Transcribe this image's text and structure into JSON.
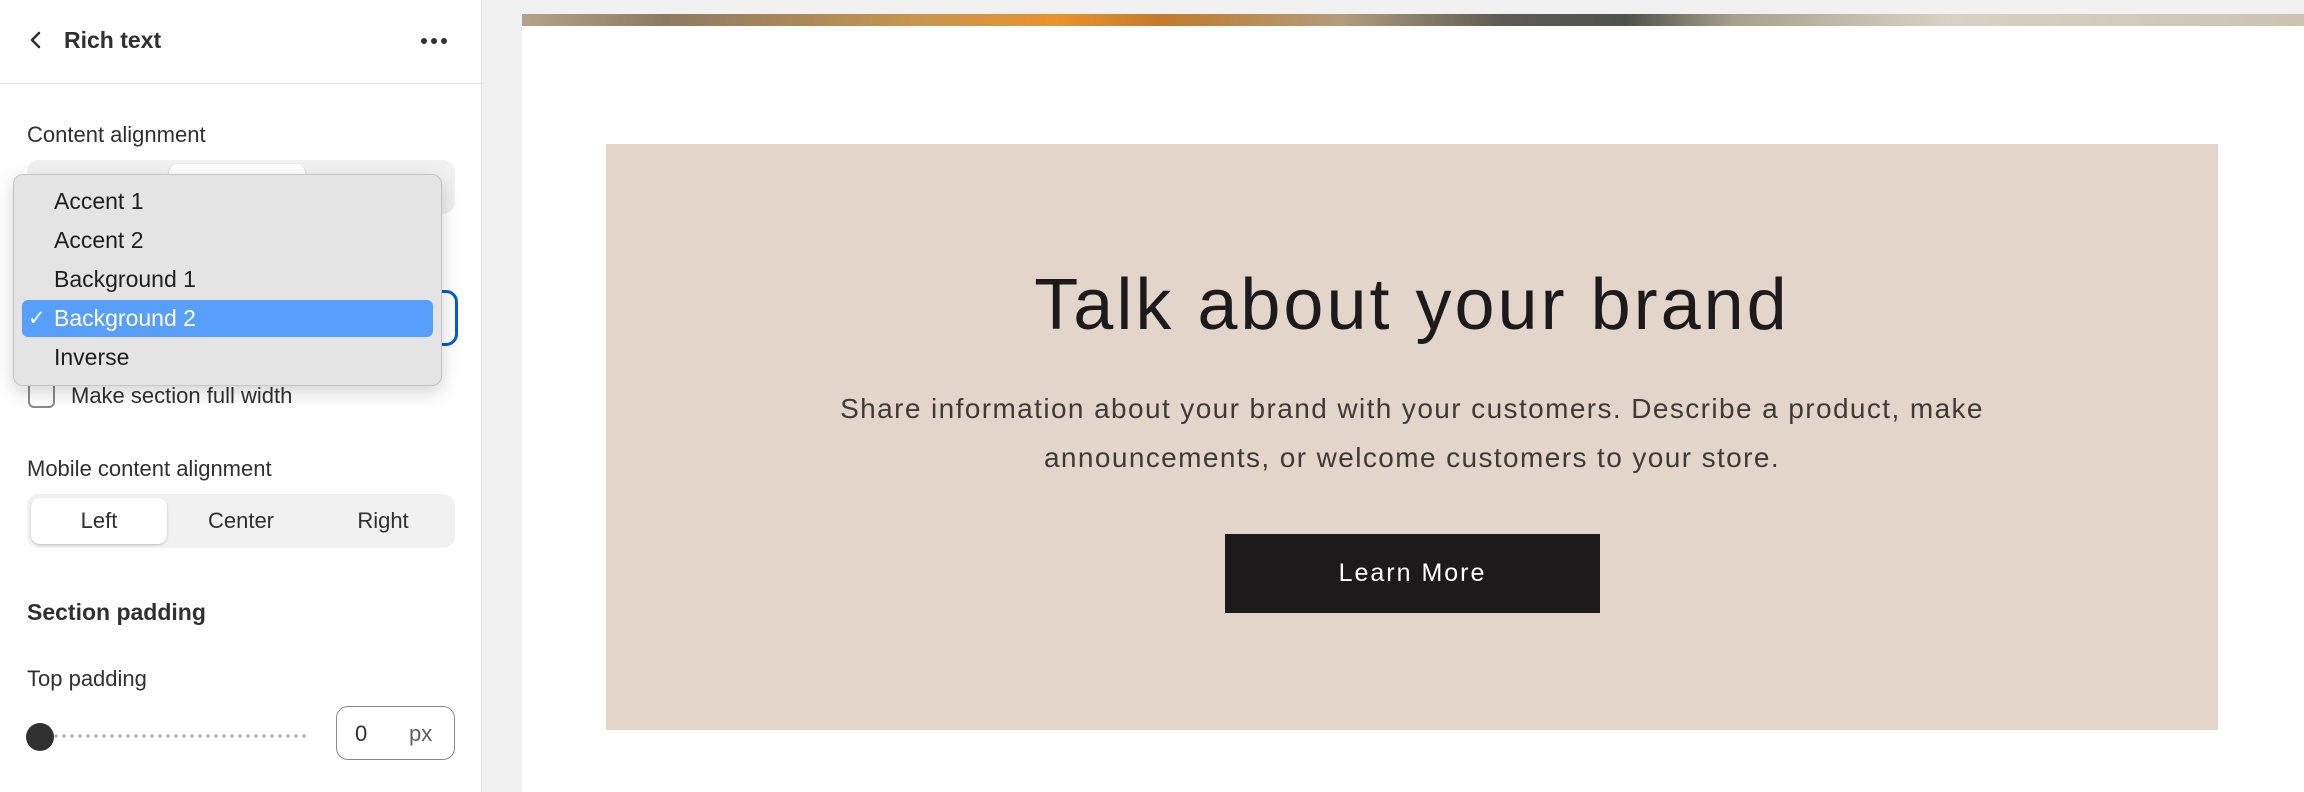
{
  "sidebar": {
    "title": "Rich text",
    "content_alignment": {
      "label": "Content alignment"
    },
    "color_scheme": {
      "options": [
        "Accent 1",
        "Accent 2",
        "Background 1",
        "Background 2",
        "Inverse"
      ],
      "selected": "Background 2",
      "check_glyph": "✓"
    },
    "full_width": {
      "label": "Make section full width",
      "checked": false
    },
    "mobile_alignment": {
      "label": "Mobile content alignment",
      "options": [
        "Left",
        "Center",
        "Right"
      ],
      "selected": "Left"
    },
    "section_padding": {
      "heading": "Section padding",
      "top_padding": {
        "label": "Top padding",
        "value": "0",
        "unit": "px"
      }
    }
  },
  "preview": {
    "heading": "Talk about your brand",
    "text": "Share information about your brand with your customers. Describe a product, make announcements, or welcome customers to your store.",
    "button": "Learn More"
  },
  "colors": {
    "accent": "#005bd3",
    "section_background": "#e3d5c9",
    "button_background": "#1c1a1a",
    "dropdown_selected": "#579ffb"
  },
  "icons": [
    "chevron-left-icon",
    "more-horizontal-icon",
    "checkmark-icon"
  ]
}
